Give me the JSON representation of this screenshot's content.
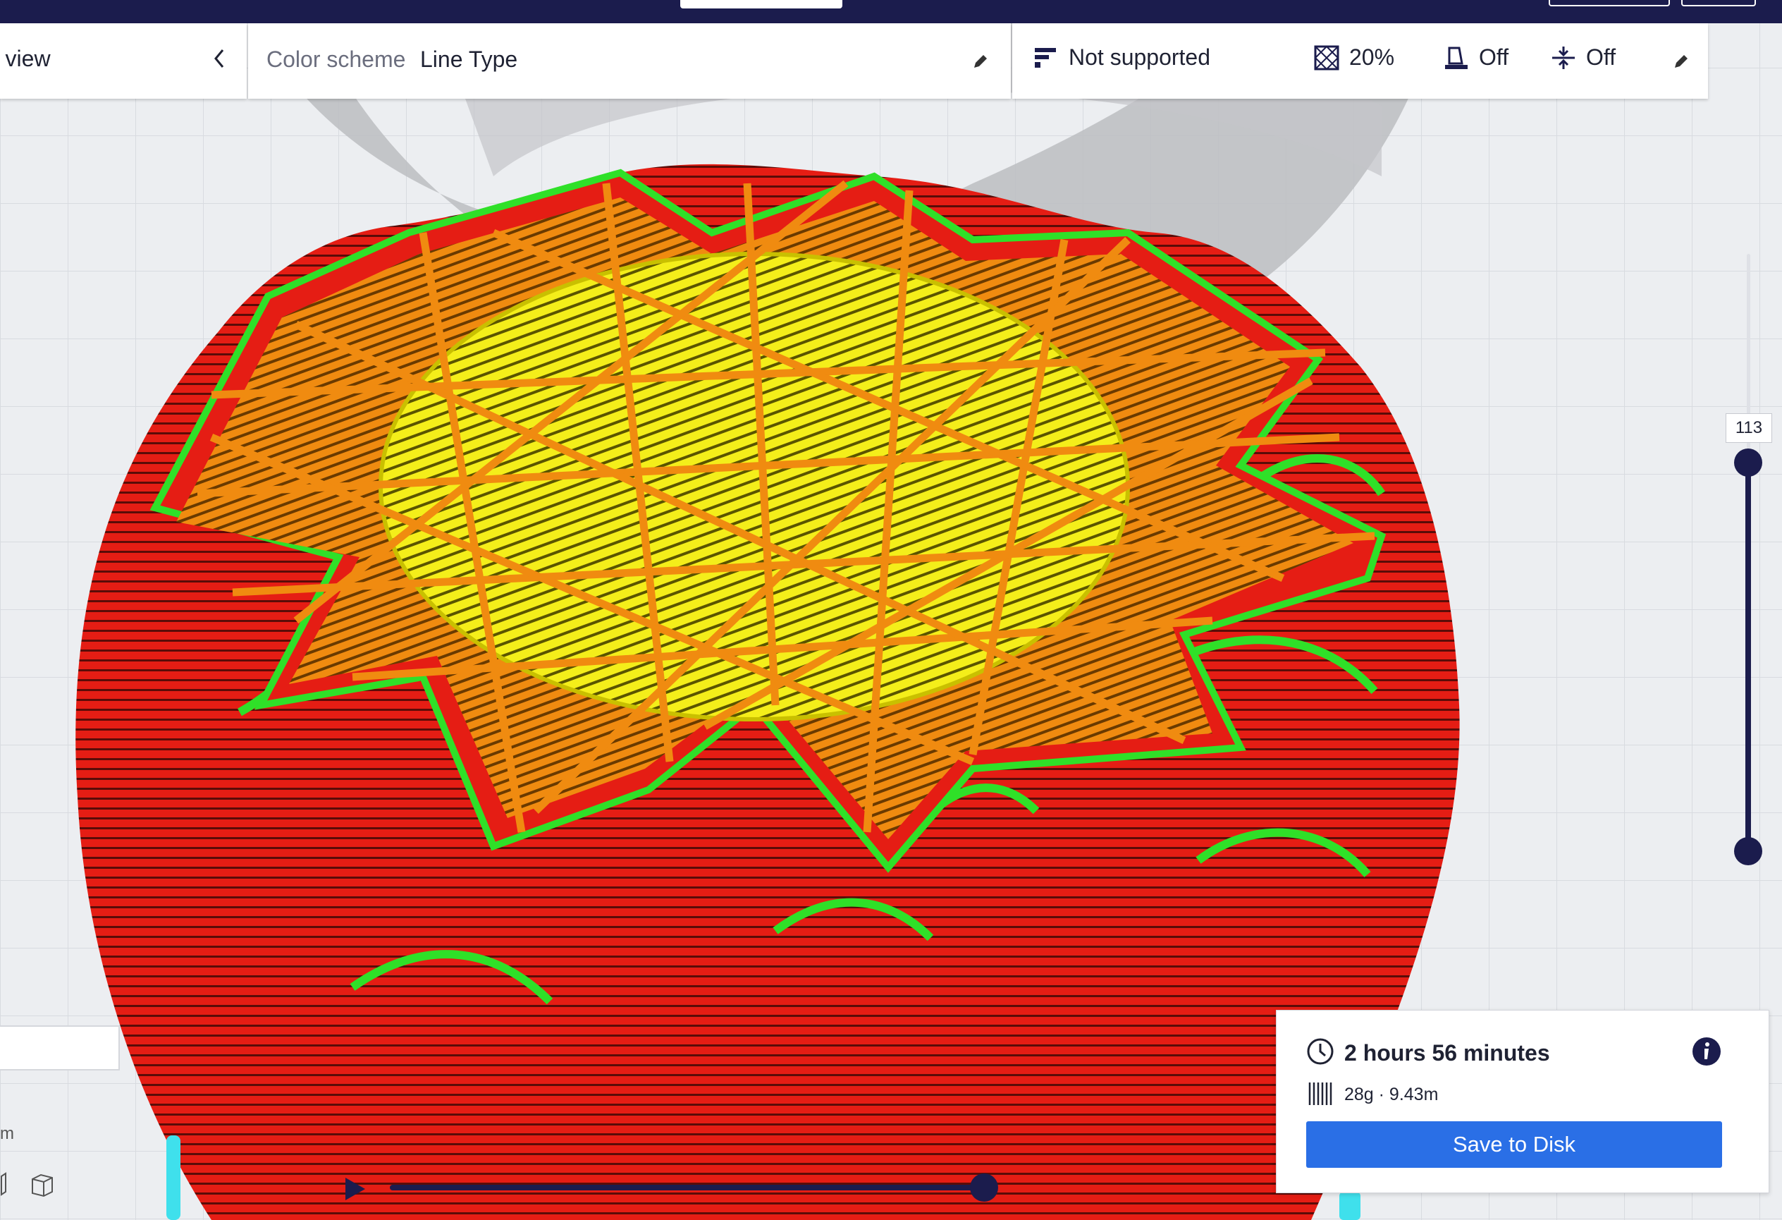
{
  "toolbar": {
    "view_label": "r view",
    "color_scheme_label": "Color scheme",
    "color_scheme_value": "Line Type",
    "support_label": "Not supported",
    "infill_value": "20%",
    "adhesion_value": "Off",
    "support_blocker_value": "Off"
  },
  "layer_slider": {
    "current_layer": "113"
  },
  "print_info": {
    "time": "2 hours 56 minutes",
    "material": "28g · 9.43m",
    "save_label": "Save to Disk"
  },
  "left_panel": {
    "unit_fragment": "m"
  },
  "colors": {
    "header": "#1b1c4d",
    "accent": "#2a6fe6",
    "wall_outer": "#e51d14",
    "wall_inner": "#2fe028",
    "infill": "#f08b10",
    "skin": "#f4ee1a",
    "build_plate": "#eceef1"
  },
  "icons": [
    "chevron-left-icon",
    "pencil-icon",
    "support-icon",
    "infill-icon",
    "adhesion-icon",
    "support-blocker-icon",
    "clock-icon",
    "info-icon",
    "spool-icon",
    "play-icon"
  ]
}
